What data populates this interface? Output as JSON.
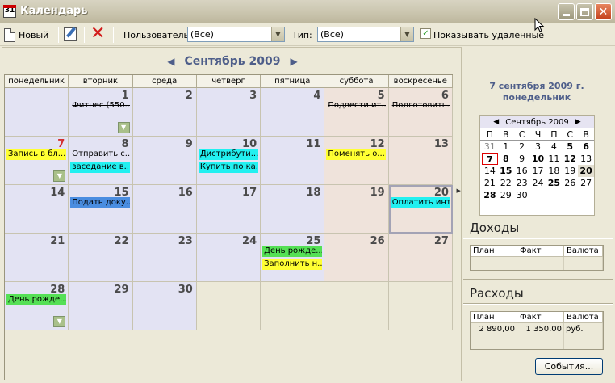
{
  "window": {
    "title": "Календарь"
  },
  "toolbar": {
    "new_label": "Новый",
    "user_label": "Пользователь:",
    "user_value": "(Все)",
    "type_label": "Тип:",
    "type_value": "(Все)",
    "show_deleted_label": "Показывать удаленные",
    "show_deleted_checked": true
  },
  "calendar": {
    "month_title": "Сентябрь 2009",
    "weekdays": [
      "понедельник",
      "вторник",
      "среда",
      "четверг",
      "пятница",
      "суббота",
      "воскресенье"
    ],
    "weeks": [
      [
        {
          "day": "",
          "events": []
        },
        {
          "day": "1",
          "events": [
            {
              "text": "Фитнес (550...",
              "color": "none",
              "strike": true
            }
          ],
          "more": true
        },
        {
          "day": "2",
          "events": []
        },
        {
          "day": "3",
          "events": []
        },
        {
          "day": "4",
          "events": []
        },
        {
          "day": "5",
          "events": [
            {
              "text": "Подвести ит...",
              "color": "none",
              "strike": true
            }
          ]
        },
        {
          "day": "6",
          "events": [
            {
              "text": "Подготовить...",
              "color": "none",
              "strike": true
            }
          ]
        }
      ],
      [
        {
          "day": "7",
          "red": true,
          "events": [
            {
              "text": "Запись в бл...",
              "color": "yellow",
              "strike": false
            }
          ],
          "more": true
        },
        {
          "day": "8",
          "events": [
            {
              "text": "Отправить с...",
              "color": "none",
              "strike": true
            },
            {
              "text": "заседание в...",
              "color": "cyan",
              "strike": false
            }
          ]
        },
        {
          "day": "9",
          "events": []
        },
        {
          "day": "10",
          "events": [
            {
              "text": "Дистрибути...",
              "color": "cyan",
              "strike": false
            },
            {
              "text": "Купить по ка...",
              "color": "cyan",
              "strike": false
            }
          ]
        },
        {
          "day": "11",
          "events": []
        },
        {
          "day": "12",
          "events": [
            {
              "text": "Поменять о...",
              "color": "yellow",
              "strike": false
            }
          ]
        },
        {
          "day": "13",
          "events": []
        }
      ],
      [
        {
          "day": "14",
          "events": []
        },
        {
          "day": "15",
          "events": [
            {
              "text": "Подать доку...",
              "color": "blue",
              "strike": false
            }
          ]
        },
        {
          "day": "16",
          "events": []
        },
        {
          "day": "17",
          "events": []
        },
        {
          "day": "18",
          "events": []
        },
        {
          "day": "19",
          "events": []
        },
        {
          "day": "20",
          "selected": true,
          "events": [
            {
              "text": "Оплатить инт...",
              "color": "cyan",
              "strike": false
            }
          ]
        }
      ],
      [
        {
          "day": "21",
          "events": []
        },
        {
          "day": "22",
          "events": []
        },
        {
          "day": "23",
          "events": []
        },
        {
          "day": "24",
          "events": []
        },
        {
          "day": "25",
          "events": [
            {
              "text": "День рожде...",
              "color": "green",
              "strike": false
            },
            {
              "text": "Заполнить н...",
              "color": "yellow",
              "strike": false
            }
          ]
        },
        {
          "day": "26",
          "events": []
        },
        {
          "day": "27",
          "events": []
        }
      ],
      [
        {
          "day": "28",
          "events": [
            {
              "text": "День рожде...",
              "color": "green",
              "strike": false
            }
          ],
          "more": true
        },
        {
          "day": "29",
          "events": []
        },
        {
          "day": "30",
          "events": []
        },
        {
          "day": "",
          "out": true,
          "events": []
        },
        {
          "day": "",
          "out": true,
          "events": []
        },
        {
          "day": "",
          "out": true,
          "events": []
        },
        {
          "day": "",
          "out": true,
          "events": []
        }
      ]
    ]
  },
  "sidebar": {
    "selected_date_line1": "7 сентября 2009 г.",
    "selected_date_line2": "понедельник",
    "mini_month_title": "Сентябрь 2009",
    "mini_weekdays": [
      "П",
      "В",
      "С",
      "Ч",
      "П",
      "С",
      "В"
    ],
    "mini_weeks": [
      [
        {
          "d": "31",
          "g": true
        },
        {
          "d": "1"
        },
        {
          "d": "2"
        },
        {
          "d": "3"
        },
        {
          "d": "4"
        },
        {
          "d": "5",
          "b": true
        },
        {
          "d": "6",
          "b": true
        }
      ],
      [
        {
          "d": "7",
          "t": true
        },
        {
          "d": "8",
          "b": true
        },
        {
          "d": "9"
        },
        {
          "d": "10",
          "b": true
        },
        {
          "d": "11"
        },
        {
          "d": "12",
          "b": true
        },
        {
          "d": "13"
        }
      ],
      [
        {
          "d": "14"
        },
        {
          "d": "15",
          "b": true
        },
        {
          "d": "16"
        },
        {
          "d": "17"
        },
        {
          "d": "18"
        },
        {
          "d": "19"
        },
        {
          "d": "20",
          "h": true
        }
      ],
      [
        {
          "d": "21"
        },
        {
          "d": "22"
        },
        {
          "d": "23"
        },
        {
          "d": "24"
        },
        {
          "d": "25",
          "b": true
        },
        {
          "d": "26"
        },
        {
          "d": "27"
        }
      ],
      [
        {
          "d": "28",
          "b": true
        },
        {
          "d": "29"
        },
        {
          "d": "30"
        },
        {
          "d": ""
        },
        {
          "d": ""
        },
        {
          "d": ""
        },
        {
          "d": ""
        }
      ]
    ],
    "income_title": "Доходы",
    "expense_title": "Расходы",
    "table_headers": [
      "План",
      "Факт",
      "Валюта"
    ],
    "income_row": [
      "",
      "",
      ""
    ],
    "expense_row": [
      "2 890,00",
      "1 350,00",
      "руб."
    ],
    "events_button": "События..."
  },
  "colors": {
    "accent": "#4e5e8a",
    "weekday_bg": "#e3e3f3",
    "weekend_bg": "#efe3db",
    "event_yellow": "#ffff33",
    "event_cyan": "#22f0f0",
    "event_blue": "#4a8de0",
    "event_green": "#55e055"
  }
}
